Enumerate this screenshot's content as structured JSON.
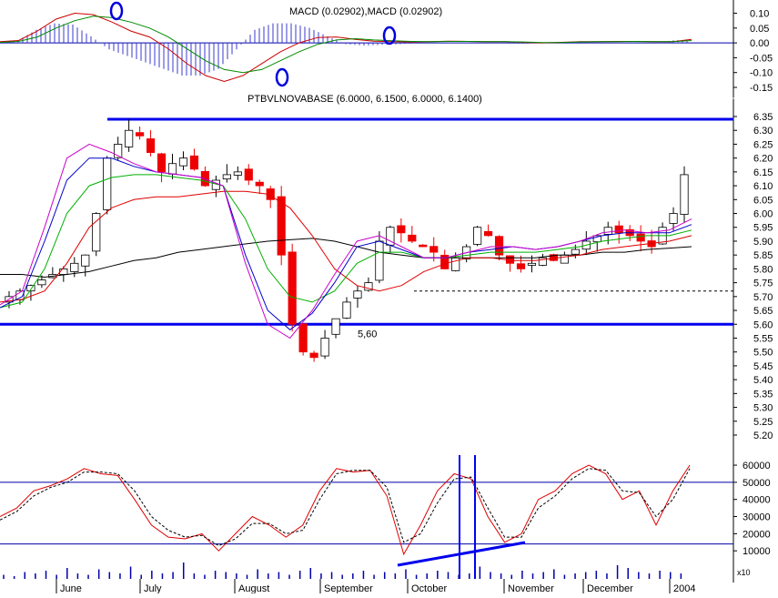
{
  "chart_data": [
    {
      "type": "line",
      "panel": "macd",
      "title": "MACD (0.02902),MACD (0.02902)",
      "ylim": [
        -0.15,
        0.12
      ],
      "yticks": [
        "0.10",
        "0.05",
        "0.00",
        "-0.05",
        "-0.10",
        "-0.15"
      ],
      "series": [
        {
          "values": [
            0.004,
            0.008,
            0.04,
            0.08,
            0.1,
            0.095,
            0.07,
            0.04,
            0.02,
            -0.02,
            -0.07,
            -0.11,
            -0.13,
            -0.11,
            -0.07,
            -0.03,
            0.0,
            0.018,
            0.02,
            0.012,
            0.006,
            0.004,
            0.003,
            0.004,
            0.006,
            0.005,
            0.004,
            0.004,
            0.002,
            0.0,
            0.002,
            0.004,
            0.004,
            0.005,
            0.005,
            0.004,
            0.004,
            0.012
          ]
        },
        {
          "values": [
            0.002,
            0.005,
            0.02,
            0.05,
            0.075,
            0.09,
            0.085,
            0.07,
            0.05,
            0.02,
            -0.02,
            -0.06,
            -0.09,
            -0.1,
            -0.09,
            -0.06,
            -0.03,
            -0.005,
            0.01,
            0.014,
            0.01,
            0.007,
            0.005,
            0.004,
            0.005,
            0.005,
            0.004,
            0.004,
            0.003,
            0.001,
            0.001,
            0.003,
            0.004,
            0.004,
            0.005,
            0.004,
            0.004,
            0.008
          ]
        }
      ],
      "histogram": [
        0.002,
        0.004,
        0.02,
        0.03,
        0.028,
        0.01,
        -0.01,
        -0.02,
        -0.03,
        -0.04,
        -0.05,
        -0.05,
        -0.04,
        -0.01,
        0.02,
        0.03,
        0.03,
        0.023,
        0.01,
        -0.002,
        -0.004,
        -0.003,
        -0.002,
        0.0,
        0.001,
        0.0,
        0.0,
        0.0,
        -0.001,
        -0.001,
        0.001,
        0.001,
        0.0,
        0.001,
        0.0,
        0.0,
        0.0,
        0.004
      ]
    },
    {
      "type": "candlestick",
      "panel": "price",
      "title": "PTBVLNOVABASE (6.0000, 6.1500, 6.0000, 6.1400)",
      "ylim": [
        5.2,
        6.35
      ],
      "yticks": [
        "6.35",
        "6.30",
        "6.25",
        "6.20",
        "6.15",
        "6.10",
        "6.05",
        "6.00",
        "5.95",
        "5.90",
        "5.85",
        "5.80",
        "5.75",
        "5.70",
        "5.65",
        "5.60",
        "5.55",
        "5.50",
        "5.45",
        "5.40",
        "5.35",
        "5.30",
        "5.25",
        "5.20"
      ],
      "xticks": [
        "June",
        "July",
        "August",
        "September",
        "October",
        "November",
        "December",
        "2004"
      ],
      "close": [
        5.7,
        5.72,
        5.74,
        5.76,
        5.78,
        5.8,
        5.82,
        5.85,
        6.0,
        6.2,
        6.25,
        6.3,
        6.28,
        6.22,
        6.15,
        6.18,
        6.2,
        6.16,
        6.1,
        6.12,
        6.14,
        6.15,
        6.12,
        6.1,
        6.05,
        5.85,
        5.6,
        5.5,
        5.48,
        5.55,
        5.62,
        5.68,
        5.72,
        5.75,
        5.9,
        5.95,
        5.93,
        5.9,
        5.88,
        5.86,
        5.8,
        5.84,
        5.88,
        5.95,
        5.92,
        5.85,
        5.82,
        5.8,
        5.82,
        5.84,
        5.83,
        5.85,
        5.87,
        5.9,
        5.92,
        5.95,
        5.93,
        5.92,
        5.9,
        5.88,
        5.95,
        6.0,
        6.14
      ],
      "series": [
        {
          "color": "#000000",
          "values": [
            5.78,
            5.78,
            5.77,
            5.78,
            5.79,
            5.81,
            5.83,
            5.84,
            5.86,
            5.87,
            5.88,
            5.89,
            5.9,
            5.905,
            5.91,
            5.9,
            5.88,
            5.86,
            5.85,
            5.84,
            5.84,
            5.84,
            5.84,
            5.84,
            5.84,
            5.85,
            5.85,
            5.86,
            5.86,
            5.87,
            5.875,
            5.88
          ]
        },
        {
          "color": "#e00000",
          "values": [
            5.68,
            5.69,
            5.72,
            5.82,
            5.95,
            6.02,
            6.05,
            6.06,
            6.06,
            6.07,
            6.08,
            6.08,
            6.07,
            6.02,
            5.92,
            5.8,
            5.74,
            5.72,
            5.74,
            5.79,
            5.82,
            5.84,
            5.84,
            5.83,
            5.83,
            5.84,
            5.85,
            5.87,
            5.88,
            5.89,
            5.9,
            5.92
          ]
        },
        {
          "color": "#00b000",
          "values": [
            5.66,
            5.68,
            5.8,
            6.0,
            6.1,
            6.13,
            6.14,
            6.14,
            6.13,
            6.12,
            6.1,
            5.98,
            5.8,
            5.7,
            5.68,
            5.72,
            5.82,
            5.86,
            5.86,
            5.84,
            5.84,
            5.85,
            5.86,
            5.86,
            5.86,
            5.87,
            5.88,
            5.9,
            5.91,
            5.92,
            5.92,
            5.94
          ]
        },
        {
          "color": "#0000cc",
          "values": [
            5.66,
            5.7,
            5.9,
            6.12,
            6.2,
            6.2,
            6.17,
            6.15,
            6.14,
            6.13,
            6.1,
            5.85,
            5.65,
            5.58,
            5.64,
            5.75,
            5.88,
            5.9,
            5.87,
            5.84,
            5.84,
            5.86,
            5.87,
            5.88,
            5.87,
            5.88,
            5.9,
            5.92,
            5.93,
            5.93,
            5.93,
            5.96
          ]
        },
        {
          "color": "#cc00cc",
          "values": [
            5.67,
            5.72,
            5.95,
            6.2,
            6.25,
            6.22,
            6.18,
            6.15,
            6.14,
            6.13,
            6.1,
            5.82,
            5.6,
            5.55,
            5.65,
            5.78,
            5.9,
            5.92,
            5.88,
            5.84,
            5.84,
            5.86,
            5.88,
            5.88,
            5.87,
            5.88,
            5.9,
            5.93,
            5.94,
            5.93,
            5.94,
            5.98
          ]
        }
      ],
      "annotations": [
        {
          "text": "5,60",
          "y": 5.6,
          "type": "support-line"
        },
        {
          "y": 6.34,
          "type": "resistance-line"
        },
        {
          "y": 5.72,
          "type": "dashed-line"
        }
      ]
    },
    {
      "type": "line",
      "panel": "stochastic",
      "ylim": [
        0,
        68000
      ],
      "yticks": [
        "60000",
        "50000",
        "40000",
        "30000",
        "20000",
        "10000"
      ],
      "levels": [
        50000,
        14000
      ],
      "series": [
        {
          "color": "#e00000",
          "values": [
            30000,
            35000,
            45000,
            48000,
            52000,
            58000,
            55000,
            54000,
            40000,
            25000,
            18000,
            17000,
            20000,
            10000,
            20000,
            30000,
            25000,
            18000,
            25000,
            45000,
            58000,
            56000,
            57000,
            42000,
            8000,
            25000,
            45000,
            55000,
            52000,
            30000,
            15000,
            20000,
            40000,
            45000,
            55000,
            60000,
            55000,
            40000,
            45000,
            25000,
            45000,
            60000
          ]
        },
        {
          "color": "#000000",
          "values": [
            28000,
            33000,
            42000,
            47000,
            50000,
            56000,
            56000,
            55000,
            45000,
            30000,
            22000,
            18000,
            19000,
            13000,
            17000,
            26000,
            26000,
            20000,
            22000,
            40000,
            55000,
            57000,
            57000,
            47000,
            15000,
            20000,
            38000,
            52000,
            53000,
            35000,
            18000,
            18000,
            35000,
            42000,
            52000,
            58000,
            57000,
            45000,
            44000,
            30000,
            40000,
            58000
          ]
        }
      ]
    },
    {
      "type": "bar",
      "panel": "volume",
      "yunit": "x10",
      "values": [
        3,
        2,
        5,
        4,
        6,
        3,
        8,
        4,
        3,
        7,
        5,
        4,
        9,
        3,
        6,
        4,
        5,
        12,
        4,
        3,
        6,
        5,
        4,
        3,
        7,
        4,
        5,
        3,
        6,
        8,
        4,
        5,
        3,
        4,
        6,
        3,
        5,
        4,
        7,
        3,
        4,
        6,
        5,
        3,
        4,
        9,
        5,
        4,
        3,
        6,
        4,
        5,
        7,
        3,
        4,
        5,
        6,
        4,
        10,
        8,
        5,
        4,
        6,
        5,
        4
      ]
    }
  ]
}
